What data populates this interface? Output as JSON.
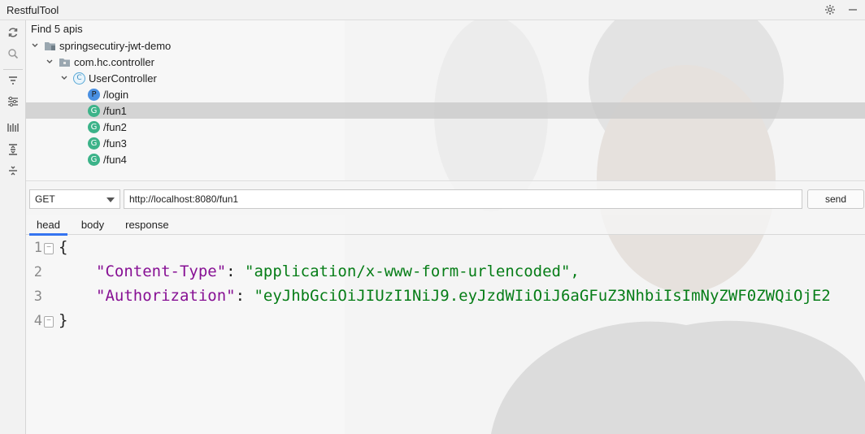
{
  "window": {
    "title": "RestfulTool"
  },
  "tree": {
    "summary": "Find 5 apis",
    "project": "springsecutiry-jwt-demo",
    "package": "com.hc.controller",
    "controller": {
      "badge": "C",
      "label": "UserController"
    },
    "endpoints": [
      {
        "badge": "P",
        "path": "/login"
      },
      {
        "badge": "G",
        "path": "/fun1"
      },
      {
        "badge": "G",
        "path": "/fun2"
      },
      {
        "badge": "G",
        "path": "/fun3"
      },
      {
        "badge": "G",
        "path": "/fun4"
      }
    ]
  },
  "request": {
    "method": "GET",
    "url": "http://localhost:8080/fun1",
    "send_label": "send"
  },
  "tabs": [
    "head",
    "body",
    "response"
  ],
  "editor": {
    "line_numbers": [
      "1",
      "2",
      "3",
      "4"
    ],
    "open_brace": "{",
    "close_brace": "}",
    "headers": [
      {
        "key": "\"Content-Type\"",
        "value": "\"application/x-www-form-urlencoded\","
      },
      {
        "key": "\"Authorization\"",
        "value": "\"eyJhbGciOiJIUzI1NiJ9.eyJzdWIiOiJ6aGFuZ3NhbiIsImNyZWF0ZWQiOjE2"
      }
    ]
  },
  "colors": {
    "accent": "#3574f0",
    "key": "#871094",
    "string": "#067d17",
    "get_badge": "#3cb389",
    "post_badge": "#4a90e2"
  }
}
